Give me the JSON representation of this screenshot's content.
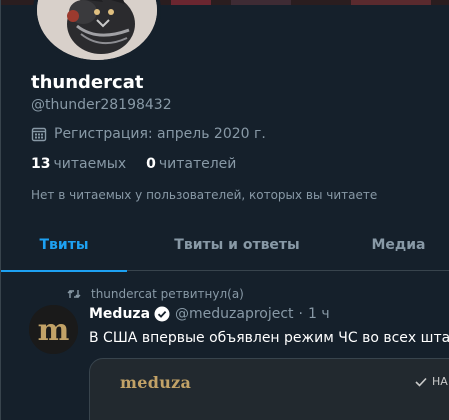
{
  "profile": {
    "display_name": "thundercat",
    "handle": "@thunder28198432",
    "joined": "Регистрация: апрель 2020 г.",
    "following_count": "13",
    "following_label": "читаемых",
    "followers_count": "0",
    "followers_label": "читателей",
    "no_followers_note": "Нет в читаемых у пользователей, которых вы читаете"
  },
  "tabs": [
    {
      "label": "Твиты",
      "active": true
    },
    {
      "label": "Твиты и ответы",
      "active": false
    },
    {
      "label": "Медиа",
      "active": false
    }
  ],
  "tweet": {
    "retweet_label": "thundercat ретвитнул(а)",
    "author": "Meduza",
    "account": "@meduzaproject",
    "separator": "·",
    "time": "1 ч",
    "text": "В США впервые объявлен режим ЧС во всех штатах",
    "card_logo": "meduza",
    "card_badge": "НА"
  },
  "colors": {
    "background": "#15202b",
    "accent": "#1da1f2",
    "muted": "#8899a6",
    "border": "#38444d",
    "meduza_gold": "#c2a267"
  },
  "icons": [
    "calendar-icon",
    "retweet-icon",
    "verified-icon",
    "checkmark-icon"
  ]
}
